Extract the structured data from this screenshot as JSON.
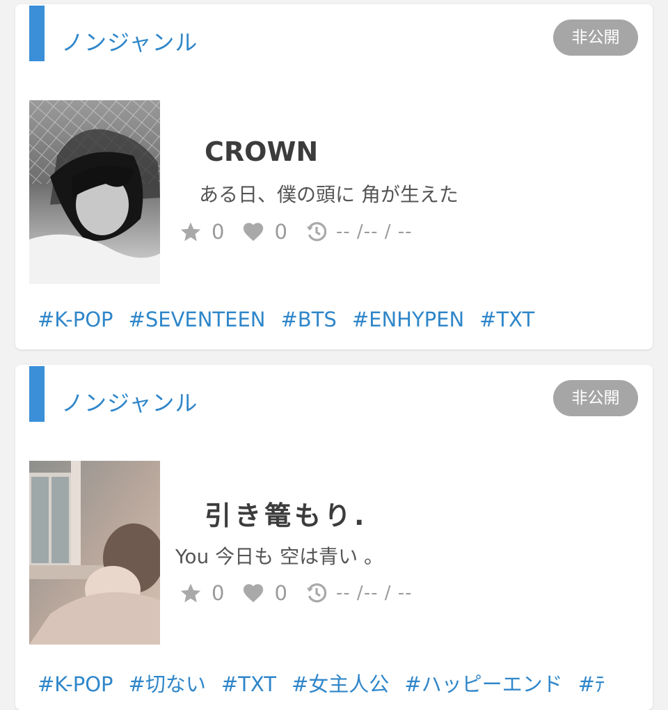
{
  "cards": [
    {
      "genre": "ノンジャンル",
      "badge": "非公開",
      "title": "CROWN",
      "subtitle": "ある日、僕の頭に 角が生えた",
      "stars": "0",
      "likes": "0",
      "updated": "-- /-- / --",
      "tags": [
        "#K-POP",
        "#SEVENTEEN",
        "#BTS",
        "#ENHYPEN",
        "#TXT"
      ]
    },
    {
      "genre": "ノンジャンル",
      "badge": "非公開",
      "title": "引き篭もり.",
      "subtitle": "You 今日も 空は青い 。",
      "stars": "0",
      "likes": "0",
      "updated": "-- /-- / --",
      "tags": [
        "#K-POP",
        "#切ない",
        "#TXT",
        "#女主人公",
        "#ハッピーエンド",
        "#ﾃ"
      ]
    }
  ],
  "colors": {
    "accent": "#3a8fd8",
    "tag": "#2f86c9",
    "badge": "#a6a6a6",
    "icon": "#a9a9a9"
  },
  "icons": [
    "star-icon",
    "heart-icon",
    "history-icon"
  ]
}
